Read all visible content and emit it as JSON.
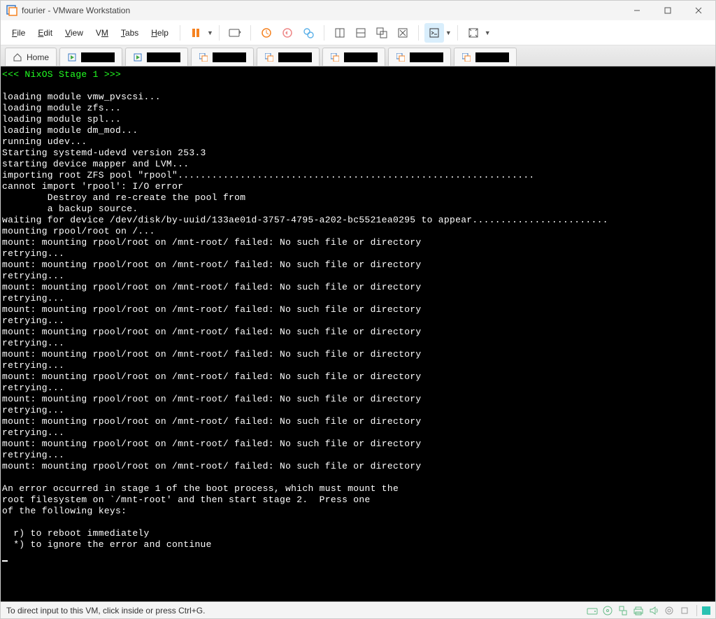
{
  "window": {
    "title": "fourier - VMware Workstation"
  },
  "menu": {
    "file": "File",
    "edit": "Edit",
    "view": "View",
    "vm": "VM",
    "tabs": "Tabs",
    "help": "Help"
  },
  "tabs": {
    "home_label": "Home",
    "vm_tabs_count": 7
  },
  "console": {
    "header": "<<< NixOS Stage 1 >>>",
    "lines": [
      "",
      "loading module vmw_pvscsi...",
      "loading module zfs...",
      "loading module spl...",
      "loading module dm_mod...",
      "running udev...",
      "Starting systemd-udevd version 253.3",
      "starting device mapper and LVM...",
      "importing root ZFS pool \"rpool\"...............................................................",
      "cannot import 'rpool': I/O error",
      "        Destroy and re-create the pool from",
      "        a backup source.",
      "waiting for device /dev/disk/by-uuid/133ae01d-3757-4795-a202-bc5521ea0295 to appear........................",
      "mounting rpool/root on /...",
      "mount: mounting rpool/root on /mnt-root/ failed: No such file or directory",
      "retrying...",
      "mount: mounting rpool/root on /mnt-root/ failed: No such file or directory",
      "retrying...",
      "mount: mounting rpool/root on /mnt-root/ failed: No such file or directory",
      "retrying...",
      "mount: mounting rpool/root on /mnt-root/ failed: No such file or directory",
      "retrying...",
      "mount: mounting rpool/root on /mnt-root/ failed: No such file or directory",
      "retrying...",
      "mount: mounting rpool/root on /mnt-root/ failed: No such file or directory",
      "retrying...",
      "mount: mounting rpool/root on /mnt-root/ failed: No such file or directory",
      "retrying...",
      "mount: mounting rpool/root on /mnt-root/ failed: No such file or directory",
      "retrying...",
      "mount: mounting rpool/root on /mnt-root/ failed: No such file or directory",
      "retrying...",
      "mount: mounting rpool/root on /mnt-root/ failed: No such file or directory",
      "retrying...",
      "mount: mounting rpool/root on /mnt-root/ failed: No such file or directory",
      "",
      "An error occurred in stage 1 of the boot process, which must mount the",
      "root filesystem on `/mnt-root' and then start stage 2.  Press one",
      "of the following keys:",
      "",
      "  r) to reboot immediately",
      "  *) to ignore the error and continue"
    ]
  },
  "statusbar": {
    "message": "To direct input to this VM, click inside or press Ctrl+G."
  }
}
